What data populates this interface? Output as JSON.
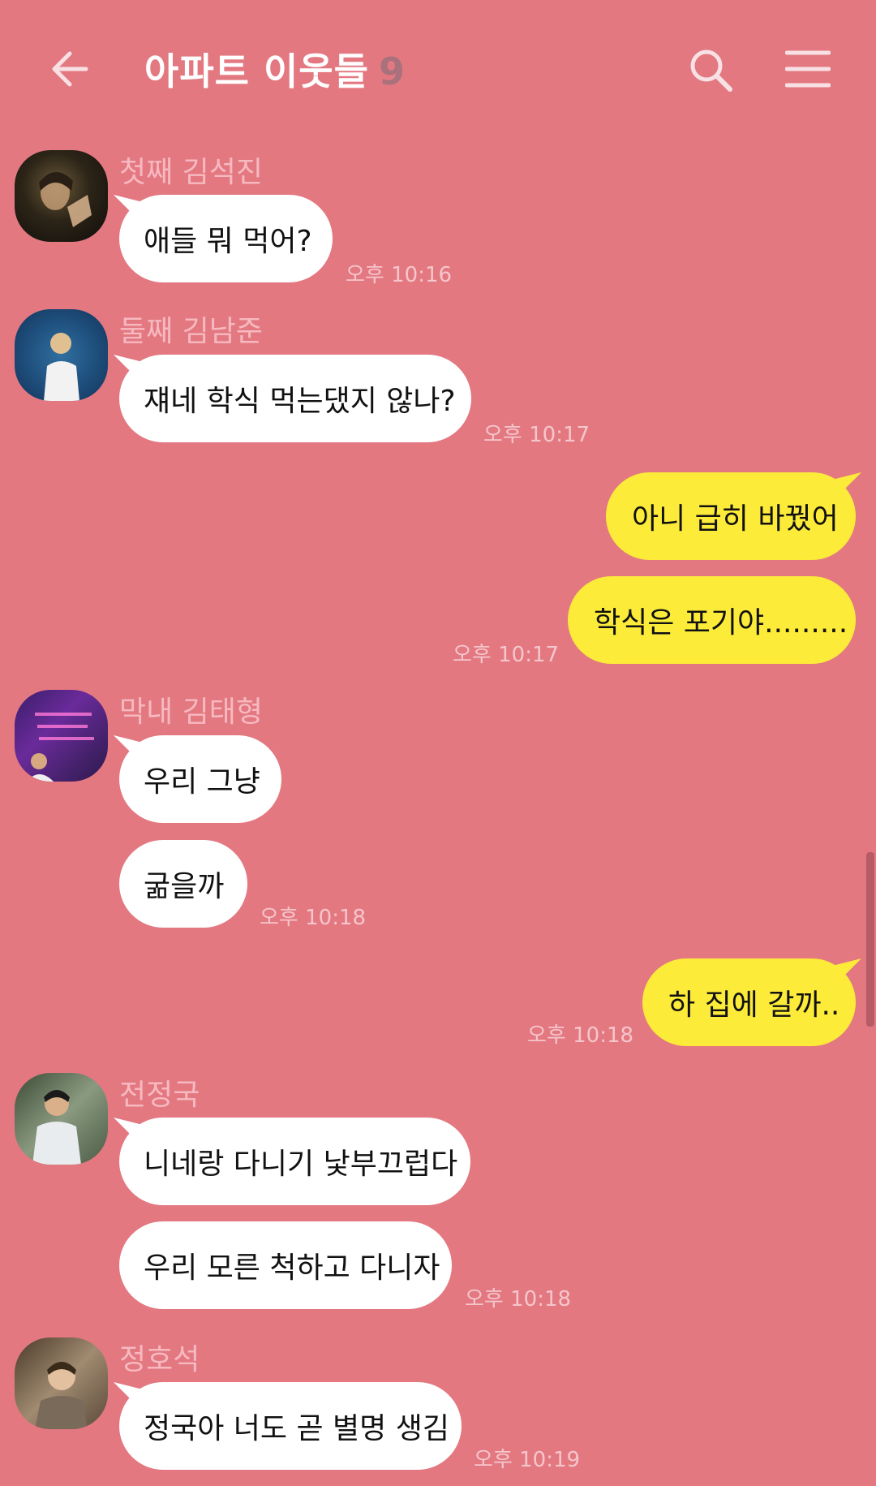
{
  "header": {
    "title": "아파트 이웃들",
    "member_count": "9"
  },
  "colors": {
    "background": "#E37881",
    "incoming_bubble": "#FFFFFF",
    "outgoing_bubble": "#FDEB3A",
    "sender_name": "#F7B9C0",
    "timestamp": "#F5C6CB"
  },
  "messages": [
    {
      "sender": "첫째 김석진",
      "text": "애들 뭐 먹어?",
      "time": "오후 10:16"
    },
    {
      "sender": "둘째 김남준",
      "text": "쟤네 학식 먹는댔지 않나?",
      "time": "오후 10:17"
    },
    {
      "outgoing": true,
      "text": "아니 급히 바꿨어"
    },
    {
      "outgoing": true,
      "text": "학식은 포기야.........",
      "time": "오후 10:17"
    },
    {
      "sender": "막내 김태형",
      "text": "우리 그냥"
    },
    {
      "text": "굶을까",
      "time": "오후 10:18"
    },
    {
      "outgoing": true,
      "text": "하 집에 갈까..",
      "time": "오후 10:18"
    },
    {
      "sender": "전정국",
      "text": "니네랑 다니기 낯부끄럽다"
    },
    {
      "text": "우리 모른 척하고 다니자",
      "time": "오후 10:18"
    },
    {
      "sender": "정호석",
      "text": "정국아 너도 곧 별명 생김",
      "time": "오후 10:19"
    }
  ],
  "avatar_icons": [
    "avatar-jin-icon",
    "avatar-namjoon-icon",
    "avatar-taehyung-icon",
    "avatar-jungkook-icon",
    "avatar-hoseok-icon"
  ]
}
